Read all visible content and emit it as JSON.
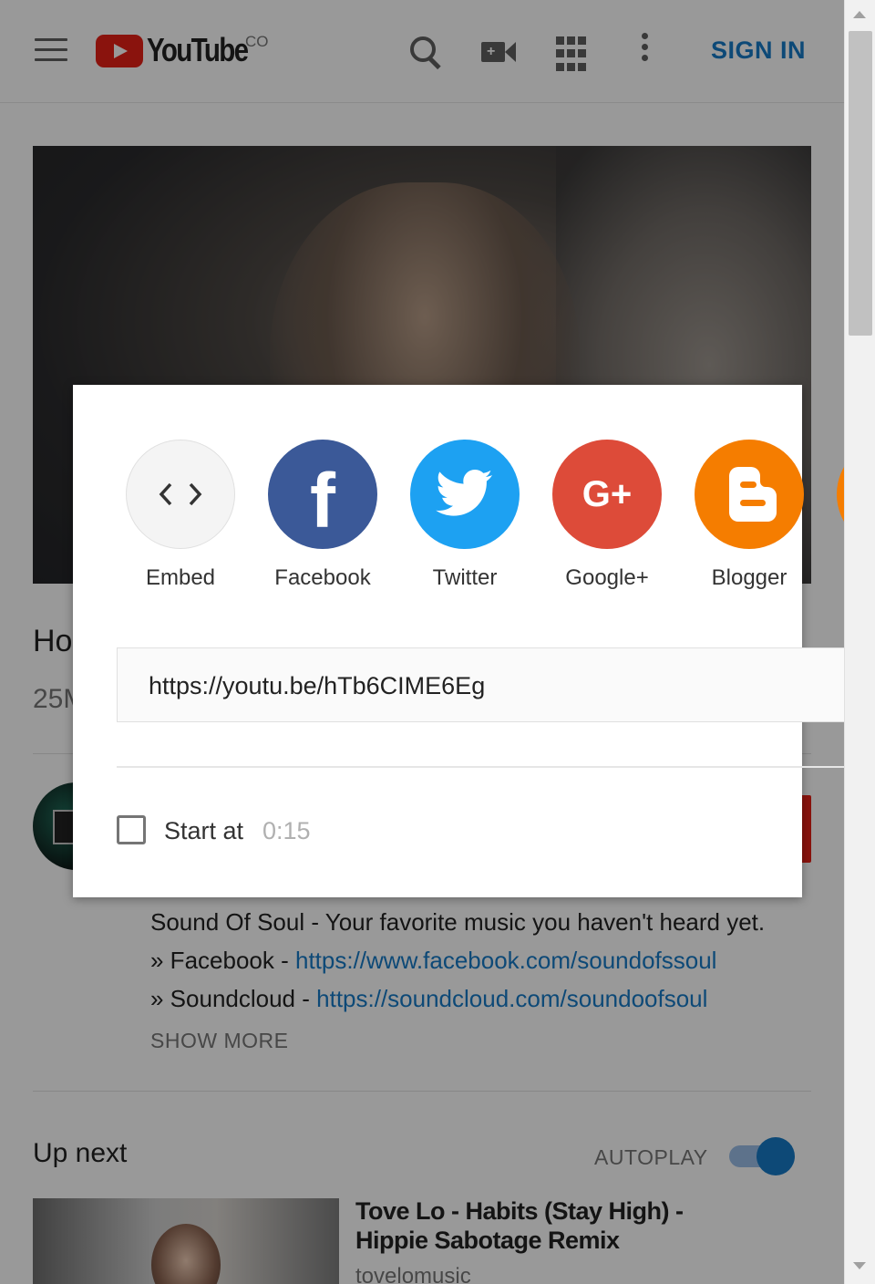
{
  "header": {
    "logo_text": "YouTube",
    "logo_country": "CO",
    "sign_in": "SIGN IN",
    "icons": [
      "menu-icon",
      "search-icon",
      "upload-video-icon",
      "apps-icon",
      "more-vert-icon"
    ]
  },
  "video": {
    "title_partial": "Ho",
    "views_partial": "25M"
  },
  "description": {
    "line1": "Sound Of Soul  - Your favorite music you haven't heard yet.",
    "line2_label": "» Facebook - ",
    "line2_link": "https://www.facebook.com/soundofssoul",
    "line3_label": "» Soundcloud - ",
    "line3_link": "https://soundcloud.com/soundoofsoul",
    "show_more": "SHOW MORE"
  },
  "up_next": {
    "heading": "Up next",
    "autoplay_label": "AUTOPLAY",
    "autoplay_on": true,
    "item": {
      "title": "Tove Lo - Habits (Stay High) - Hippie Sabotage Remix",
      "channel": "tovelomusic"
    }
  },
  "share_dialog": {
    "targets": [
      {
        "label": "Embed",
        "icon": "code-icon",
        "color": "#f4f4f4"
      },
      {
        "label": "Facebook",
        "icon": "facebook-icon",
        "color": "#3b5998"
      },
      {
        "label": "Twitter",
        "icon": "twitter-icon",
        "color": "#1da1f2"
      },
      {
        "label": "Google+",
        "icon": "google-plus-icon",
        "color": "#dd4b39"
      },
      {
        "label": "Blogger",
        "icon": "blogger-icon",
        "color": "#f57d00"
      }
    ],
    "url": "https://youtu.be/hTb6CIME6Eg",
    "start_at_label": "Start at",
    "start_at_time": "0:15",
    "start_at_checked": false
  },
  "colors": {
    "brand_red": "#e62117",
    "link_blue": "#167ac6"
  }
}
